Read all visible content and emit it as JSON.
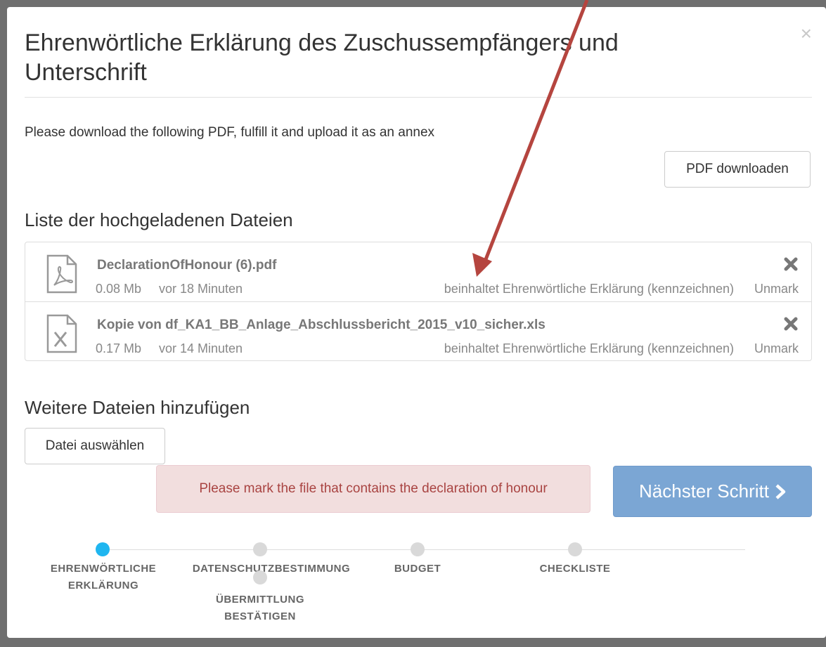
{
  "modal": {
    "title": "Ehrenwörtliche Erklärung des Zuschussempfängers und Unterschrift",
    "close_symbol": "×",
    "instruction": "Please download the following PDF, fulfill it and upload it as an annex",
    "pdf_button": "PDF downloaden",
    "files_heading": "Liste der hochgeladenen Dateien",
    "files": [
      {
        "icon": "pdf-file-icon",
        "name": "DeclarationOfHonour (6).pdf",
        "size": "0.08 Mb",
        "time": "vor 18 Minuten",
        "mark_text": "beinhaltet Ehrenwörtliche Erklärung (kennzeichnen)",
        "unmark": "Unmark"
      },
      {
        "icon": "excel-file-icon",
        "name": "Kopie von df_KA1_BB_Anlage_Abschlussbericht_2015_v10_sicher.xls",
        "size": "0.17 Mb",
        "time": "vor 14 Minuten",
        "mark_text": "beinhaltet Ehrenwörtliche Erklärung (kennzeichnen)",
        "unmark": "Unmark"
      }
    ],
    "add_heading": "Weitere Dateien hinzufügen",
    "choose_button": "Datei auswählen",
    "alert": "Please mark the file that contains the declaration of honour",
    "next_button": "Nächster Schritt",
    "next_icon": "chevron-right-icon"
  },
  "steps": [
    {
      "label_line1": "EHRENWÖRTLICHE",
      "label_line2": "ERKLÄRUNG",
      "active": true
    },
    {
      "label_line1": "DATENSCHUTZBESTIMMUNG",
      "label_line2": "",
      "active": false
    },
    {
      "label_line1": "ÜBERMITTLUNG",
      "label_line2": "BESTÄTIGEN",
      "active": false
    },
    {
      "label_line1": "BUDGET",
      "label_line2": "",
      "active": false
    },
    {
      "label_line1": "CHECKLISTE",
      "label_line2": "",
      "active": false
    }
  ],
  "colors": {
    "accent_active_step": "#1fb6f0",
    "next_button_bg": "#7ba6d4",
    "alert_bg": "#f2dede",
    "alert_text": "#a94442",
    "annotation_arrow": "#b5453f"
  }
}
